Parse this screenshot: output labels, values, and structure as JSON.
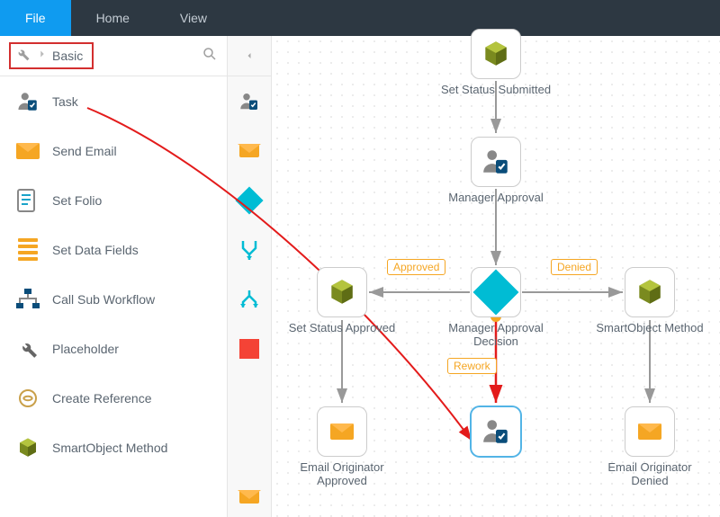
{
  "menu": {
    "file": "File",
    "home": "Home",
    "view": "View"
  },
  "breadcrumb": {
    "category": "Basic"
  },
  "tools": [
    {
      "key": "task",
      "label": "Task"
    },
    {
      "key": "send-email",
      "label": "Send Email"
    },
    {
      "key": "set-folio",
      "label": "Set Folio"
    },
    {
      "key": "set-data-fields",
      "label": "Set Data Fields"
    },
    {
      "key": "call-sub-workflow",
      "label": "Call Sub Workflow"
    },
    {
      "key": "placeholder",
      "label": "Placeholder"
    },
    {
      "key": "create-reference",
      "label": "Create Reference"
    },
    {
      "key": "smartobject-method",
      "label": "SmartObject Method"
    }
  ],
  "nodes": {
    "set_status_submitted": "Set Status Submitted",
    "manager_approval": "Manager Approval",
    "manager_approval_decision": "Manager Approval Decision",
    "set_status_approved": "Set Status Approved",
    "smartobject_method": "SmartObject Method",
    "email_originator_approved": "Email Originator Approved",
    "email_originator_denied": "Email Originator Denied"
  },
  "edges": {
    "approved": "Approved",
    "denied": "Denied",
    "rework": "Rework"
  }
}
